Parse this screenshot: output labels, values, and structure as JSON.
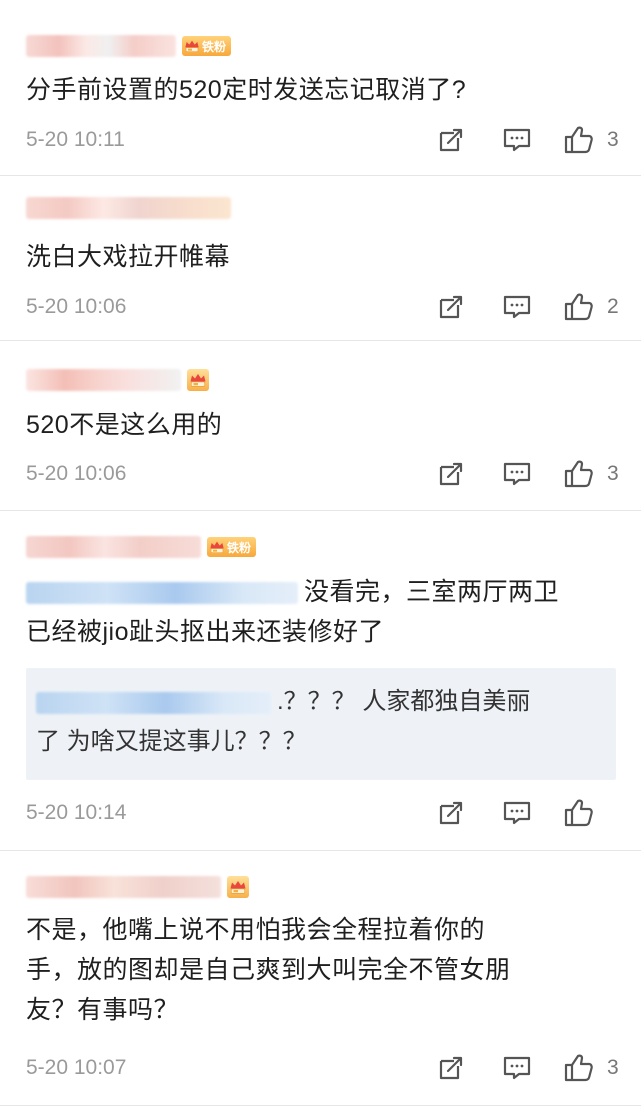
{
  "fan_badge_label": "铁粉",
  "comments": [
    {
      "text": "分手前设置的520定时发送忘记取消了?",
      "time": "5-20 10:11",
      "likes": "3",
      "badge": "fan"
    },
    {
      "text": "洗白大戏拉开帷幕",
      "time": "5-20 10:06",
      "likes": "2",
      "badge": "none"
    },
    {
      "text": "520不是这么用的",
      "time": "5-20 10:06",
      "likes": "3",
      "badge": "icon"
    },
    {
      "text_after_mention": "没看完，三室两厅两卫",
      "text_line2": "已经被jio趾头抠出来还装修好了",
      "quote_line1": ".？？？ 人家都独自美丽",
      "quote_line2": "了 为啥又提这事儿？？？",
      "time": "5-20 10:14",
      "likes": "",
      "badge": "fan"
    },
    {
      "text_line1": "不是，他嘴上说不用怕我会全程拉着你的",
      "text_line2": "手，放的图却是自己爽到大叫完全不管女朋",
      "text_line3": "友？有事吗？",
      "time": "5-20 10:07",
      "likes": "3",
      "badge": "icon"
    }
  ],
  "icons": {
    "repost": "repost-icon",
    "comment": "comment-icon",
    "like": "thumbs-up-icon",
    "crown": "crown-icon"
  },
  "colors": {
    "meta_gray": "#9a9a9a",
    "icon_gray": "#666666",
    "badge_orange": "#f7a83b",
    "quote_bg": "#eef2f7"
  }
}
